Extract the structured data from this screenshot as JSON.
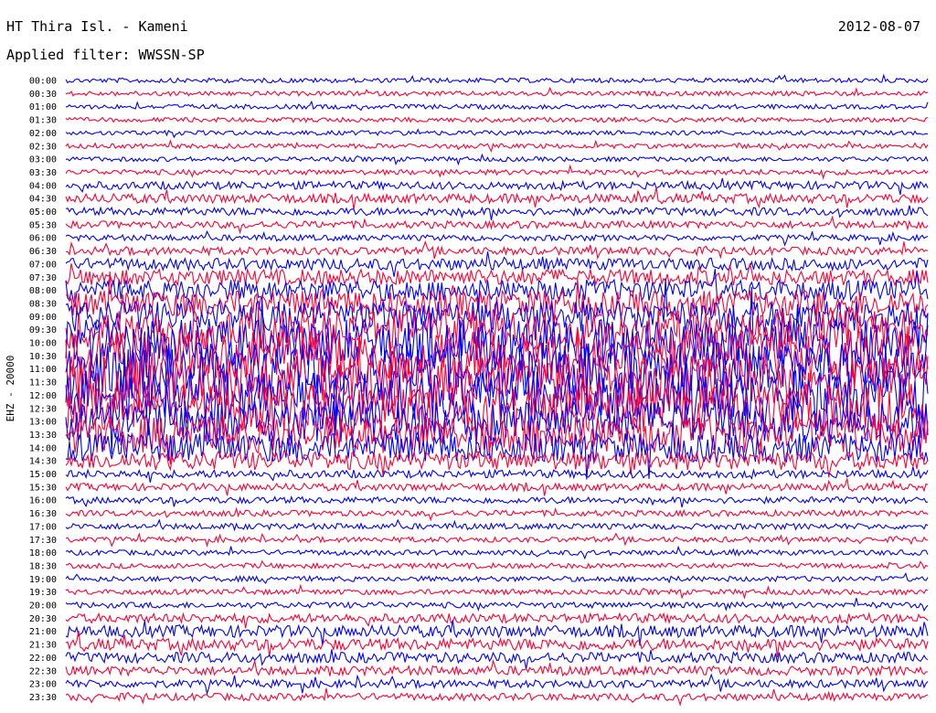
{
  "header": {
    "station": "HT Thira Isl. - Kameni",
    "date": "2012-08-07",
    "filter": "Applied filter: WWSSN-SP"
  },
  "chart_data": {
    "type": "helicorder",
    "ylabel": "EHZ - 20000",
    "time_labels": [
      "00:00",
      "00:30",
      "01:00",
      "01:30",
      "02:00",
      "02:30",
      "03:00",
      "03:30",
      "04:00",
      "04:30",
      "05:00",
      "05:30",
      "06:00",
      "06:30",
      "07:00",
      "07:30",
      "08:00",
      "08:30",
      "09:00",
      "09:30",
      "10:00",
      "10:30",
      "11:00",
      "11:30",
      "12:00",
      "12:30",
      "13:00",
      "13:30",
      "14:00",
      "14:30",
      "15:00",
      "15:30",
      "16:00",
      "16:30",
      "17:00",
      "17:30",
      "18:00",
      "18:30",
      "19:00",
      "19:30",
      "20:00",
      "20:30",
      "21:00",
      "21:30",
      "22:00",
      "22:30",
      "23:00",
      "23:30"
    ],
    "trace_colors": [
      "#0000ff",
      "#ff0033"
    ],
    "relative_amplitude": [
      0.35,
      0.35,
      0.35,
      0.35,
      0.35,
      0.35,
      0.35,
      0.4,
      0.6,
      0.7,
      0.6,
      0.55,
      0.45,
      0.6,
      0.9,
      1.2,
      1.6,
      2.0,
      2.4,
      3.0,
      3.6,
      4.0,
      4.0,
      4.0,
      3.8,
      3.6,
      3.2,
      2.8,
      2.2,
      1.4,
      0.6,
      0.55,
      0.5,
      0.45,
      0.45,
      0.4,
      0.4,
      0.4,
      0.4,
      0.4,
      0.45,
      0.7,
      0.9,
      0.9,
      0.8,
      0.7,
      0.6,
      0.55
    ]
  }
}
